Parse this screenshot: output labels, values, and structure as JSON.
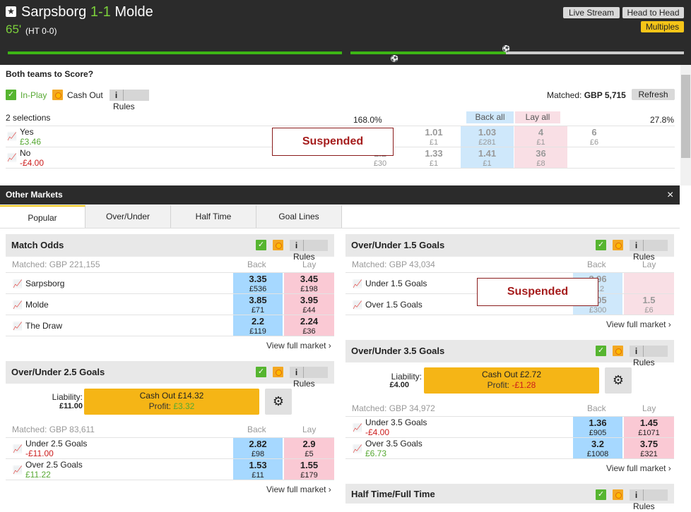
{
  "match": {
    "home": "Sarpsborg",
    "score": "1-1",
    "away": "Molde",
    "minute": "65'",
    "ht": "(HT 0-0)",
    "live_stream": "Live Stream",
    "head_to_head": "Head to Head",
    "multiples": "Multiples"
  },
  "bts": {
    "title": "Both teams to Score?",
    "inplay": "In-Play",
    "cashout": "Cash Out",
    "rules": "Rules",
    "matched_label": "Matched:",
    "matched_value": "GBP 5,715",
    "refresh": "Refresh",
    "selections": "2 selections",
    "pct_back": "168.0%",
    "pct_lay": "27.8%",
    "back_all": "Back all",
    "lay_all": "Lay all",
    "suspended": "Suspended",
    "rows": [
      {
        "name": "Yes",
        "pl": "£3.46",
        "b3": {
          "o": "",
          "s": ""
        },
        "b2": {
          "o": "1.01",
          "s": "£1"
        },
        "b1": {
          "o": "1.03",
          "s": "£281"
        },
        "l1": {
          "o": "4",
          "s": "£1"
        },
        "l2": {
          "o": "6",
          "s": "£6"
        }
      },
      {
        "name": "No",
        "pl": "-£4.00",
        "b3": {
          "o": "1.2",
          "s": "£30"
        },
        "b2": {
          "o": "1.33",
          "s": "£1"
        },
        "b1": {
          "o": "1.41",
          "s": "£1"
        },
        "l1": {
          "o": "36",
          "s": "£8"
        },
        "l2": {
          "o": "",
          "s": ""
        }
      }
    ]
  },
  "other": {
    "title": "Other Markets",
    "close": "×",
    "tabs": [
      "Popular",
      "Over/Under",
      "Half Time",
      "Goal Lines"
    ]
  },
  "match_odds": {
    "title": "Match Odds",
    "rules": "Rules",
    "matched": "Matched: GBP 221,155",
    "back": "Back",
    "lay": "Lay",
    "view": "View full market ›",
    "rows": [
      {
        "name": "Sarpsborg",
        "bo": "3.35",
        "bs": "£536",
        "lo": "3.45",
        "ls": "£198"
      },
      {
        "name": "Molde",
        "bo": "3.85",
        "bs": "£71",
        "lo": "3.95",
        "ls": "£44"
      },
      {
        "name": "The Draw",
        "bo": "2.2",
        "bs": "£119",
        "lo": "2.24",
        "ls": "£36"
      }
    ]
  },
  "ou25": {
    "title": "Over/Under 2.5 Goals",
    "rules": "Rules",
    "liability_label": "Liability:",
    "liability": "£11.00",
    "cashout": "Cash Out £14.32",
    "profit_label": "Profit:",
    "profit": "£3.32",
    "matched": "Matched: GBP 83,611",
    "back": "Back",
    "lay": "Lay",
    "view": "View full market ›",
    "rows": [
      {
        "name": "Under 2.5 Goals",
        "pl": "-£11.00",
        "bo": "2.82",
        "bs": "£98",
        "lo": "2.9",
        "ls": "£5"
      },
      {
        "name": "Over 2.5 Goals",
        "pl": "£11.22",
        "bo": "1.53",
        "bs": "£11",
        "lo": "1.55",
        "ls": "£179"
      }
    ]
  },
  "ou15": {
    "title": "Over/Under 1.5 Goals",
    "rules": "Rules",
    "matched": "Matched: GBP 43,034",
    "back": "Back",
    "lay": "Lay",
    "suspended": "Suspended",
    "view": "View full market ›",
    "rows": [
      {
        "name": "Under 1.5 Goals",
        "bo": "2.96",
        "bs": "£12",
        "lo": "",
        "ls": ""
      },
      {
        "name": "Over 1.5 Goals",
        "bo": "1.05",
        "bs": "£300",
        "lo": "1.5",
        "ls": "£6"
      }
    ]
  },
  "ou35": {
    "title": "Over/Under 3.5 Goals",
    "rules": "Rules",
    "liability_label": "Liability:",
    "liability": "£4.00",
    "cashout": "Cash Out £2.72",
    "profit_label": "Profit:",
    "profit": "-£1.28",
    "matched": "Matched: GBP 34,972",
    "back": "Back",
    "lay": "Lay",
    "view": "View full market ›",
    "rows": [
      {
        "name": "Under 3.5 Goals",
        "pl": "-£4.00",
        "bo": "1.36",
        "bs": "£905",
        "lo": "1.45",
        "ls": "£1071"
      },
      {
        "name": "Over 3.5 Goals",
        "pl": "£6.73",
        "bo": "3.2",
        "bs": "£1008",
        "lo": "3.75",
        "ls": "£321"
      }
    ]
  },
  "htft": {
    "title": "Half Time/Full Time",
    "rules": "Rules"
  },
  "icons": {
    "star": "star-icon",
    "ball": "football-icon",
    "check": "check-icon",
    "cashout": "cashout-icon",
    "info": "info-icon",
    "chart": "chart-icon",
    "sliders": "sliders-icon",
    "close": "close-icon"
  }
}
